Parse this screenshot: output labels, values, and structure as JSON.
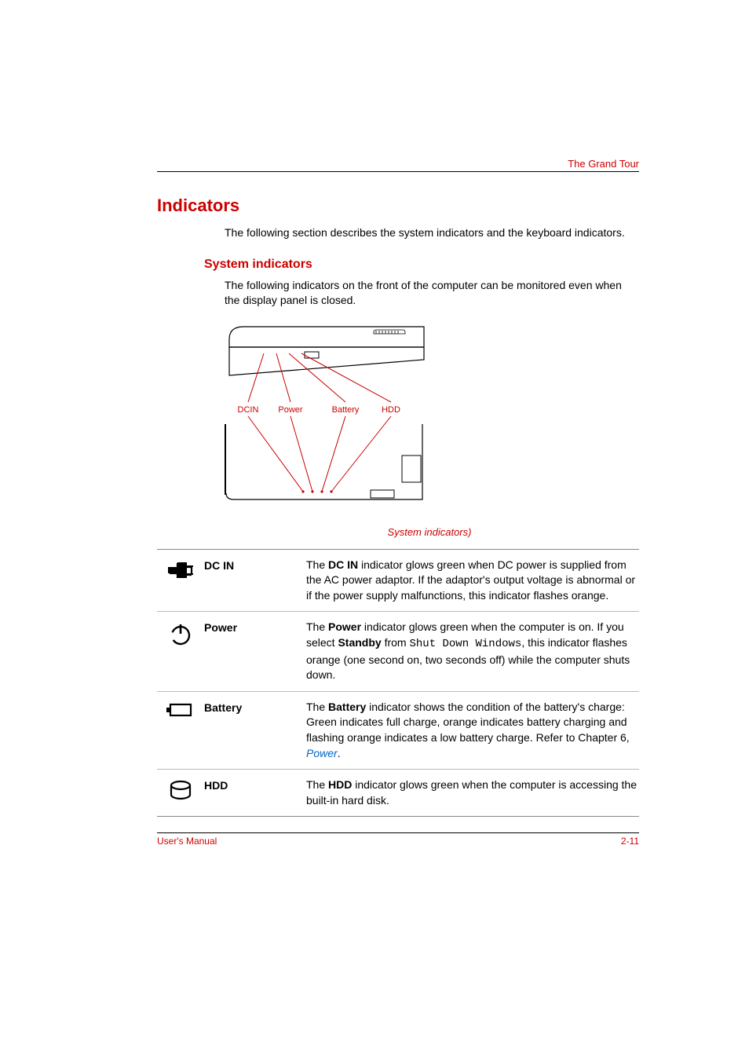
{
  "header": {
    "section": "The Grand Tour"
  },
  "title": "Indicators",
  "intro": "The following section describes the system indicators and the keyboard indicators.",
  "subsection": "System indicators",
  "sub_intro": "The following indicators on the front of the computer can be monitored even when the display panel is closed.",
  "diagram": {
    "labels": {
      "dcin": "DCIN",
      "power": "Power",
      "battery": "Battery",
      "hdd": "HDD"
    },
    "caption": "System indicators)"
  },
  "rows": {
    "dcin": {
      "label": "DC IN",
      "desc_pre": "The ",
      "desc_bold": "DC IN",
      "desc_post": " indicator glows green when DC power is supplied from the AC power adaptor. If the adaptor's output voltage is abnormal or if the power supply malfunctions, this indicator flashes orange."
    },
    "power": {
      "label": "Power",
      "p1": "The ",
      "p1b": "Power",
      "p2": " indicator glows green when the computer is on. If you select ",
      "p2b": "Standby",
      "p3": " from ",
      "mono": "Shut Down Windows",
      "p4": ", this indicator flashes orange (one second on, two seconds off) while the computer shuts down."
    },
    "battery": {
      "label": "Battery",
      "p1": "The ",
      "p1b": "Battery",
      "p2": " indicator shows the condition of the battery's charge: Green indicates full charge, orange indicates battery charging and flashing orange indicates a low battery charge. Refer to Chapter 6, ",
      "link": "Power",
      "p3": "."
    },
    "hdd": {
      "label": "HDD",
      "p1": "The ",
      "p1b": "HDD",
      "p2": " indicator glows green when the computer is accessing the built-in hard disk."
    }
  },
  "footer": {
    "left": "User's Manual",
    "right": "2-11"
  }
}
